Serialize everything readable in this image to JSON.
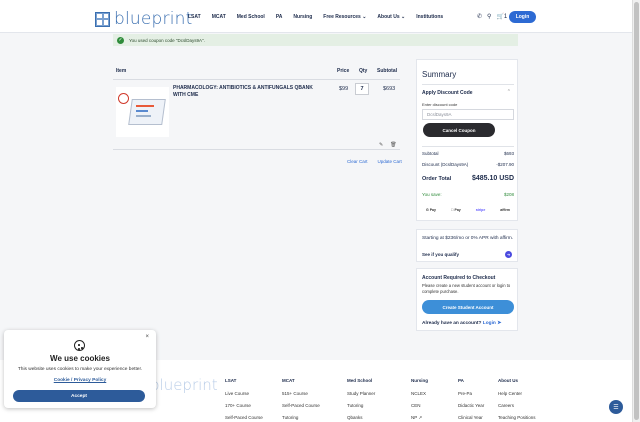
{
  "header": {
    "logo_text": "blueprint",
    "nav": [
      "LSAT",
      "MCAT",
      "Med School",
      "PA",
      "Nursing",
      "Free Resources ⌄",
      "About Us ⌄",
      "Institutions"
    ],
    "cart_count": "1",
    "login_label": "Login"
  },
  "alert": {
    "message": "You used coupon code \"DcslDays9A\"."
  },
  "cart": {
    "columns": {
      "item": "Item",
      "price": "Price",
      "qty": "Qty",
      "subtotal": "Subtotal"
    },
    "item": {
      "name": "PHARMACOLOGY: ANTIBIOTICS & ANTIFUNGALS QBANK WITH CME",
      "price": "$99",
      "qty": "7",
      "subtotal": "$693"
    },
    "clear_label": "Clear Cart",
    "update_label": "Update Cart"
  },
  "summary": {
    "title": "Summary",
    "apply_label": "Apply Discount Code",
    "enter_label": "Enter discount code",
    "code_value": "DcslDays9A",
    "cancel_label": "Cancel Coupon",
    "subtotal_label": "Subtotal",
    "subtotal_value": "$693",
    "discount_label": "Discount (DcslDays9A)",
    "discount_value": "-$207.90",
    "total_label": "Order Total",
    "total_value": "$485.10 USD",
    "save_label": "You save:",
    "save_value": "$208",
    "payments": [
      "G Pay",
      " Pay",
      "stripe",
      "affirm"
    ]
  },
  "affirm": {
    "line1": "Starting at $236/mo or 0% APR with affirm.",
    "cta": "See if you qualify"
  },
  "checkout": {
    "heading": "Account Required to Checkout",
    "body": "Please create a new student account or login to complete purchase.",
    "create_label": "Create Student Account",
    "already": "Already have an account?",
    "login_link": "Login"
  },
  "footer": {
    "logo_text": "blueprint",
    "columns": [
      {
        "title": "LSAT",
        "items": [
          "Live Course",
          "170+ Course",
          "Self-Paced Course"
        ]
      },
      {
        "title": "MCAT",
        "items": [
          "515+ Course",
          "Self-Paced Course",
          "Tutoring"
        ]
      },
      {
        "title": "Med School",
        "items": [
          "Study Planner",
          "Tutoring",
          "Qbanks"
        ]
      },
      {
        "title": "Nursing",
        "items": [
          "NCLEX",
          "CEN",
          "NP ↗"
        ]
      },
      {
        "title": "PA",
        "items": [
          "Pre-Pa",
          "Didactic Year",
          "Clinical Year"
        ]
      },
      {
        "title": "About Us",
        "items": [
          "Help Center",
          "Careers",
          "Teaching Positions"
        ]
      }
    ]
  },
  "cookie": {
    "heading": "We use cookies",
    "body": "This website uses cookies to make your experience better.",
    "link": "Cookie / Privacy Policy",
    "accept_label": "Accept"
  }
}
